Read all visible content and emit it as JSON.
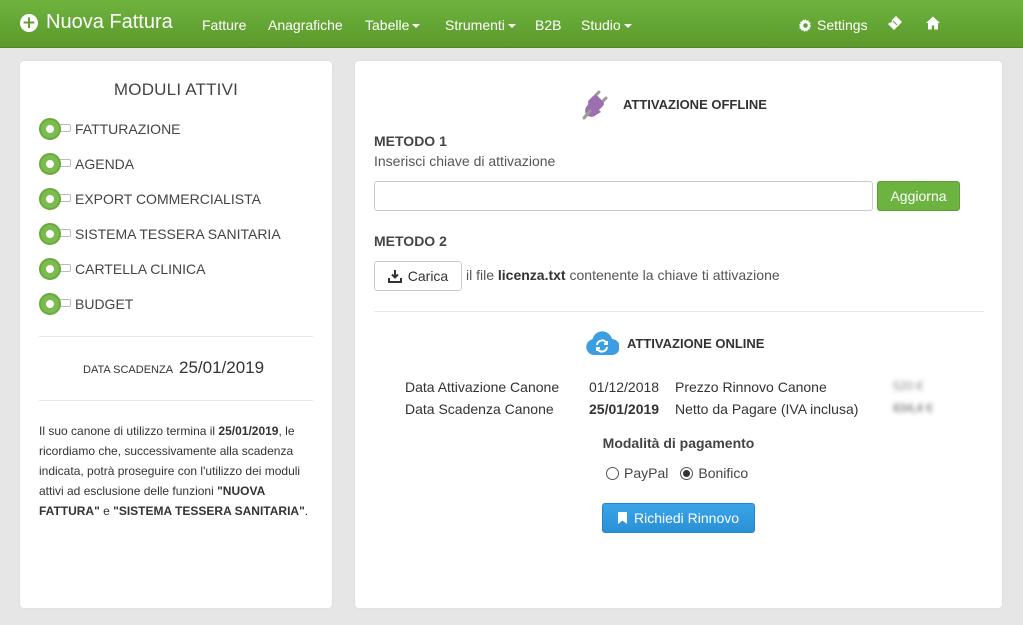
{
  "navbar": {
    "brand": "Nuova Fattura",
    "items": [
      {
        "label": "Fatture"
      },
      {
        "label": "Anagrafiche"
      },
      {
        "label": "Tabelle"
      },
      {
        "label": "Strumenti"
      },
      {
        "label": "B2B"
      },
      {
        "label": "Studio"
      }
    ],
    "settings_label": "Settings"
  },
  "modules": {
    "title": "MODULI ATTIVI",
    "items": [
      {
        "label": "FATTURAZIONE"
      },
      {
        "label": "AGENDA"
      },
      {
        "label": "EXPORT COMMERCIALISTA"
      },
      {
        "label": "SISTEMA TESSERA SANITARIA"
      },
      {
        "label": "CARTELLA CLINICA"
      },
      {
        "label": "BUDGET"
      }
    ],
    "expiry_label": "DATA SCADENZA",
    "expiry_date": "25/01/2019",
    "notice": {
      "p1": "Il suo canone di utilizzo termina il ",
      "date": "25/01/2019",
      "p2": ", le ricordiamo che, successivamente alla scadenza indicata, potrà proseguire con l'utilizzo dei moduli attivi ad esclusione delle funzioni ",
      "f1": "\"NUOVA FATTURA\"",
      "p3": " e ",
      "f2": "\"SISTEMA TESSERA SANITARIA\"",
      "p4": "."
    }
  },
  "offline": {
    "title": "ATTIVAZIONE OFFLINE",
    "method1_title": "METODO 1",
    "method1_hint": "Inserisci chiave di attivazione",
    "key_value": "",
    "update_button": "Aggiorna",
    "method2_title": "METODO 2",
    "upload_button": "Carica",
    "upload_pre": "il file ",
    "upload_file": "licenza.txt",
    "upload_post": " contenente la chiave ti attivazione"
  },
  "online": {
    "title": "ATTIVAZIONE ONLINE",
    "activation_label": "Data Attivazione Canone",
    "activation_date": "01/12/2018",
    "expiry_label": "Data Scadenza Canone",
    "expiry_date": "25/01/2019",
    "renewal_price_label": "Prezzo Rinnovo Canone",
    "renewal_price": "520 €",
    "net_label": "Netto da Pagare (IVA inclusa)",
    "net_value": "634,4 €",
    "payment_title": "Modalità di pagamento",
    "payment_options": [
      {
        "label": "PayPal",
        "selected": false
      },
      {
        "label": "Bonifico",
        "selected": true
      }
    ],
    "renew_button": "Richiedi Rinnovo"
  },
  "colors": {
    "navbar": "#62a533",
    "toggle_on": "#7cbb4d",
    "green_button": "#6cb33f",
    "blue_button": "#2f98dd",
    "plug_icon": "#9b6fb0",
    "cloud_icon": "#3b9ee2"
  }
}
